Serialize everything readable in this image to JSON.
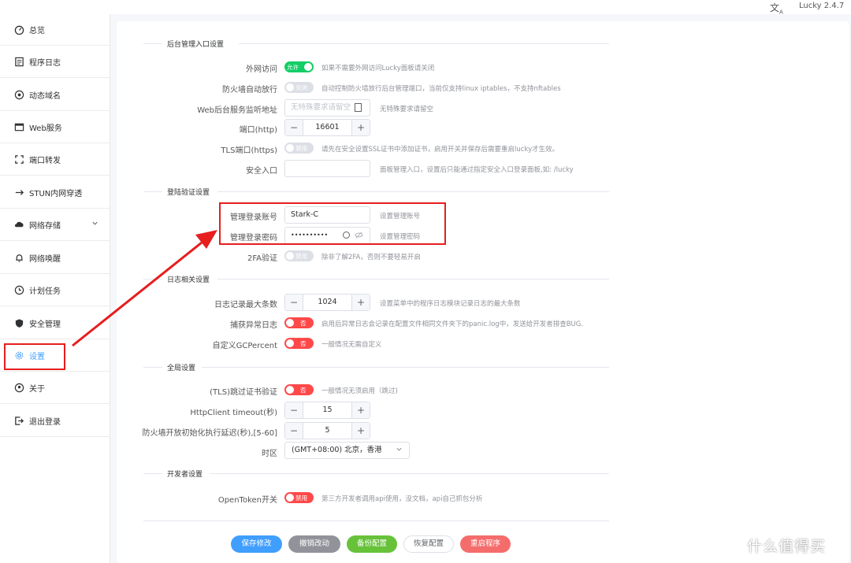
{
  "topbar": {
    "lang_icon": "translate-icon",
    "version": "Lucky 2.4.7"
  },
  "sidebar": {
    "items": [
      {
        "label": "总览",
        "icon": "dashboard-icon"
      },
      {
        "label": "程序日志",
        "icon": "log-icon"
      },
      {
        "label": "动态域名",
        "icon": "ddns-icon"
      },
      {
        "label": "Web服务",
        "icon": "web-service-icon"
      },
      {
        "label": "端口转发",
        "icon": "port-forward-icon"
      },
      {
        "label": "STUN内网穿透",
        "icon": "stun-icon"
      },
      {
        "label": "网络存储",
        "icon": "storage-icon"
      },
      {
        "label": "网络唤醒",
        "icon": "bell-icon"
      },
      {
        "label": "计划任务",
        "icon": "clock-icon"
      },
      {
        "label": "安全管理",
        "icon": "shield-icon"
      },
      {
        "label": "设置",
        "icon": "gear-icon"
      },
      {
        "label": "关于",
        "icon": "about-icon"
      },
      {
        "label": "退出登录",
        "icon": "logout-icon"
      }
    ]
  },
  "sections": {
    "admin": "后台管理入口设置",
    "login": "登陆验证设置",
    "log": "日志相关设置",
    "global": "全局设置",
    "dev": "开发者设置"
  },
  "admin": {
    "external_label": "外网访问",
    "external_switch": "允许",
    "external_hint": "如果不需要外网访问Lucky面板请关闭",
    "firewall_label": "防火墙自动放行",
    "firewall_switch": "关闭",
    "firewall_hint": "自动控制防火墙放行后台管理端口，当前仅支持linux iptables，不支持nftables",
    "listen_label": "Web后台服务监听地址",
    "listen_placeholder": "无特殊要求请留空",
    "listen_hint": "无特殊要求请留空",
    "http_port_label": "端口(http)",
    "http_port_value": "16601",
    "tls_label": "TLS端口(https)",
    "tls_switch": "禁用",
    "tls_hint": "请先在安全设置SSL证书中添加证书，启用开关并保存后需要重启lucky才生效。",
    "entry_label": "安全入口",
    "entry_value": "",
    "entry_hint": "面板管理入口，设置后只能通过指定安全入口登录面板,如: /lucky"
  },
  "login": {
    "account_label": "管理登录账号",
    "account_value": "Stark-C",
    "account_hint": "设置管理账号",
    "password_label": "管理登录密码",
    "password_value": "••••••••••",
    "password_hint": "设置管理密码",
    "twofa_label": "2FA验证",
    "twofa_switch": "禁用",
    "twofa_hint": "除非了解2FA，否则不要轻易开启"
  },
  "log": {
    "max_label": "日志记录最大条数",
    "max_value": "1024",
    "max_hint": "设置菜单中的程序日志模块记录日志的最大条数",
    "panic_label": "捕获异常日志",
    "panic_switch": "否",
    "panic_hint": "启用后异常日志会记录在配置文件相同文件夹下的panic.log中，发送给开发者排查BUG.",
    "gc_label": "自定义GCPercent",
    "gc_switch": "否",
    "gc_hint": "一般情况无需自定义"
  },
  "global": {
    "tls_skip_label": "(TLS)跳过证书验证",
    "tls_skip_switch": "否",
    "tls_skip_hint": "一般情况无须启用（跳过)",
    "timeout_label": "HttpClient timeout(秒)",
    "timeout_value": "15",
    "delay_label": "防火墙开放初始化执行延迟(秒),[5-60]",
    "delay_value": "5",
    "tz_label": "时区",
    "tz_value": "(GMT+08:00) 北京，香港"
  },
  "dev": {
    "token_label": "OpenToken开关",
    "token_switch": "禁用",
    "token_hint": "第三方开发者调用api使用，没文档，api自己抓包分析"
  },
  "footer": {
    "save": "保存修改",
    "undo": "撤销改动",
    "backup": "备份配置",
    "restore": "恢复配置",
    "restart": "重启程序"
  },
  "watermark": "什么值得买",
  "colors": {
    "accent": "#409eff",
    "switch_on": "#13ce66",
    "switch_red": "#ff4949",
    "annotation": "#e61e1e"
  }
}
